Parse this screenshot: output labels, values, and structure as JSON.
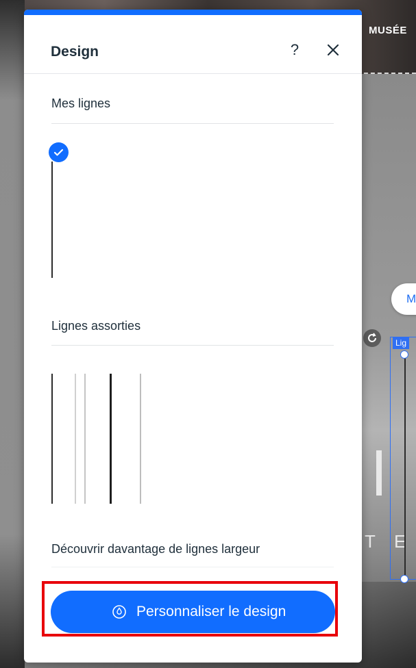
{
  "background": {
    "header_menu_text": "MUSÉE",
    "pill_text": "M",
    "selection_tag": "Lig",
    "letter_1": "T",
    "letter_2": "E"
  },
  "panel": {
    "title": "Design",
    "help_label": "?",
    "help_icon": "question-icon",
    "close_icon": "close-icon",
    "my_lines_label": "Mes lignes",
    "assorted_label": "Lignes assorties",
    "discover_label": "Découvrir davantage de lignes largeur",
    "cta_label": "Personnaliser le design",
    "cta_icon": "drop-icon",
    "accent_color": "#116dff",
    "highlight_color": "#e8000b"
  },
  "assorted_lines": [
    {
      "name": "thin-dark",
      "color": "#2b2b2b"
    },
    {
      "name": "thin-light",
      "color": "#d0d0d0"
    },
    {
      "name": "thin-gray",
      "color": "#c4c4c4"
    },
    {
      "name": "thick-dark",
      "color": "#1e1e1e"
    },
    {
      "name": "thin-silver",
      "color": "#bdbdbd"
    }
  ]
}
